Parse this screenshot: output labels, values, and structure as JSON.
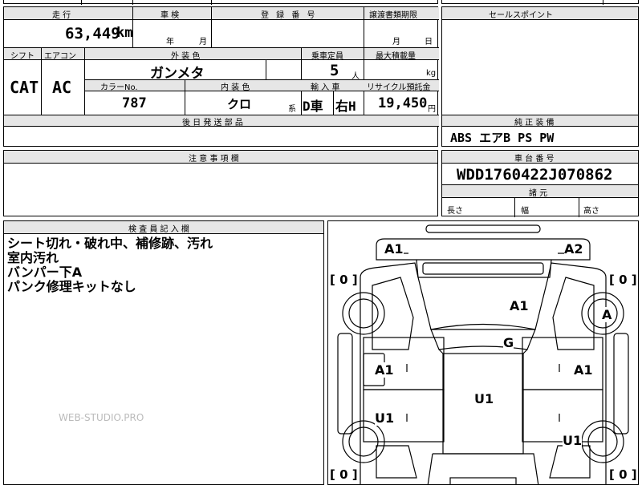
{
  "top_strip": {
    "partial_a": "",
    "partial_b": ""
  },
  "mileage": {
    "header": "走 行",
    "value": "63,449",
    "unit": "km"
  },
  "inspection": {
    "header": "車 検",
    "year_unit": "年",
    "month_unit": "月"
  },
  "registration": {
    "header": "登 録 番 号"
  },
  "transfer": {
    "header": "譲渡書類期限",
    "month_unit": "月",
    "day_unit": "日"
  },
  "transmission": {
    "header": "シフト",
    "value": "CAT"
  },
  "aircon": {
    "header": "エアコン",
    "value": "AC"
  },
  "exterior_color": {
    "header": "外 装 色",
    "value": "ガンメタ"
  },
  "seating": {
    "header": "乗車定員",
    "value": "5",
    "unit": "人"
  },
  "max_load": {
    "header": "最大積載量",
    "unit": "kg"
  },
  "color_no": {
    "header": "カラーNo.",
    "value": "787"
  },
  "interior_color": {
    "header": "内 装 色",
    "value": "クロ",
    "unit": "系"
  },
  "import": {
    "header": "輸 入 車",
    "value": "D車",
    "steering": "右H"
  },
  "recycle": {
    "header": "リサイクル預託金",
    "value": "19,450",
    "unit": "円"
  },
  "later_parts": {
    "header": "後 日 発 送 部 品"
  },
  "sales_points": {
    "header": "セールスポイント"
  },
  "equipment": {
    "header": "純 正 装 備",
    "value": "ABS エアB PS PW"
  },
  "notes": {
    "header": "注 意 事 項 欄"
  },
  "chassis": {
    "header": "車 台 番 号",
    "value": "WDD1760422J070862"
  },
  "dimensions": {
    "header": "諸 元",
    "length": "長さ",
    "width": "幅",
    "height": "高さ"
  },
  "inspector": {
    "header": "検 査 員 記 入 欄",
    "lines": [
      "シート切れ・破れ中、補修跡、汚れ",
      "室内汚れ",
      "バンパー下A",
      "パンク修理キットなし"
    ]
  },
  "watermark": "WEB-STUDIO.PRO",
  "diagram": {
    "tire_fl": "[ 0 ]",
    "tire_fr": "[ 0 ]",
    "tire_rl": "[ 0 ]",
    "tire_rr": "[ 0 ]",
    "marks": {
      "front_left": "A1",
      "front_right": "A2",
      "hood": "A1",
      "front_wheel_right": "A",
      "windshield": "G",
      "door_left_front": "A1",
      "door_right_front": "A1",
      "roof": "U1",
      "door_left_rear": "U1",
      "door_right_rear": "U1"
    }
  }
}
